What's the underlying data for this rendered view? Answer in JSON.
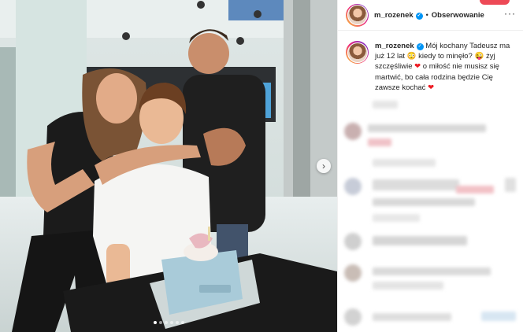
{
  "post": {
    "username": "m_rozenek",
    "follow_label": "Obserwowanie",
    "separator": "•",
    "more_label": "···",
    "caption": {
      "username": "m_rozenek",
      "line1": "Mój kochany Tadeusz ma już 12 lat",
      "emoji1": "😳",
      "line2": "kiedy to minęło?",
      "emoji2": "😜",
      "line3": "żyj szczęśliwie",
      "heart1": "❤",
      "line4": "o miłość nie musisz się martwić, bo cała rodzina będzie Cię zawsze kochać",
      "heart2": "❤"
    },
    "carousel": {
      "slides": 6,
      "active": 0,
      "next_icon": "›"
    },
    "colors": {
      "verified": "#0095f6",
      "accent": "#ed4956"
    }
  }
}
